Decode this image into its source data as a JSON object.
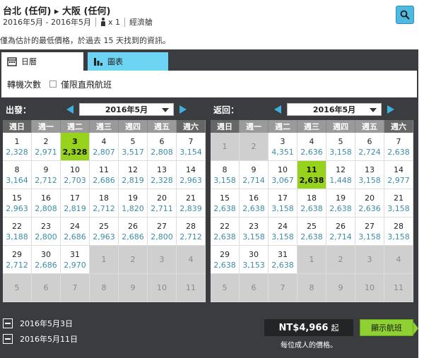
{
  "header": {
    "route": "台北 (任何) ▸ 大阪 (任何)",
    "dates": "2016年5月 - 2016年5月",
    "passengers": "x 1",
    "cabin": "經濟艙"
  },
  "notice": "僅為估計的最低價格，於過去 15 天找到的資訊。",
  "tabs": {
    "calendar": "日曆",
    "chart": "圖表"
  },
  "options": {
    "stops_label": "轉機次數",
    "direct_only": "僅限直飛航班"
  },
  "weekdays": [
    "週日",
    "週一",
    "週二",
    "週三",
    "週四",
    "週五",
    "週六"
  ],
  "outbound": {
    "label": "出發：",
    "month": "2016年5月",
    "cells": [
      {
        "d": "1",
        "p": "2,328"
      },
      {
        "d": "2",
        "p": "2,971"
      },
      {
        "d": "3",
        "p": "2,328",
        "sel": true
      },
      {
        "d": "4",
        "p": "2,807"
      },
      {
        "d": "5",
        "p": "3,517"
      },
      {
        "d": "6",
        "p": "2,808"
      },
      {
        "d": "7",
        "p": "3,154"
      },
      {
        "d": "8",
        "p": "3,164"
      },
      {
        "d": "9",
        "p": "2,712"
      },
      {
        "d": "10",
        "p": "2,703"
      },
      {
        "d": "11",
        "p": "2,686"
      },
      {
        "d": "12",
        "p": "2,819"
      },
      {
        "d": "13",
        "p": "2,328"
      },
      {
        "d": "14",
        "p": "2,963"
      },
      {
        "d": "15",
        "p": "2,963"
      },
      {
        "d": "16",
        "p": "2,808"
      },
      {
        "d": "17",
        "p": "2,819"
      },
      {
        "d": "18",
        "p": "2,712"
      },
      {
        "d": "19",
        "p": "1,820"
      },
      {
        "d": "20",
        "p": "2,711"
      },
      {
        "d": "21",
        "p": "2,839"
      },
      {
        "d": "22",
        "p": "3,188"
      },
      {
        "d": "23",
        "p": "2,800"
      },
      {
        "d": "24",
        "p": "2,686"
      },
      {
        "d": "25",
        "p": "2,963"
      },
      {
        "d": "26",
        "p": "2,686"
      },
      {
        "d": "27",
        "p": "2,800"
      },
      {
        "d": "28",
        "p": "2,712"
      },
      {
        "d": "29",
        "p": "2,712"
      },
      {
        "d": "30",
        "p": "2,686"
      },
      {
        "d": "31",
        "p": "2,970"
      },
      {
        "d": "1",
        "out": true
      },
      {
        "d": "2",
        "out": true
      },
      {
        "d": "3",
        "out": true
      },
      {
        "d": "4",
        "out": true
      },
      {
        "d": "5",
        "out": true
      },
      {
        "d": "6",
        "out": true
      },
      {
        "d": "7",
        "out": true
      },
      {
        "d": "8",
        "out": true
      },
      {
        "d": "9",
        "out": true
      },
      {
        "d": "10",
        "out": true
      },
      {
        "d": "11",
        "out": true
      }
    ]
  },
  "return": {
    "label": "返回：",
    "month": "2016年5月",
    "cells": [
      {
        "d": "1",
        "out": true
      },
      {
        "d": "2",
        "out": true
      },
      {
        "d": "3",
        "p": "4,351"
      },
      {
        "d": "4",
        "p": "2,636"
      },
      {
        "d": "5",
        "p": "3,158"
      },
      {
        "d": "6",
        "p": "2,724"
      },
      {
        "d": "7",
        "p": "2,638"
      },
      {
        "d": "8",
        "p": "3,158"
      },
      {
        "d": "9",
        "p": "2,714"
      },
      {
        "d": "10",
        "p": "3,067"
      },
      {
        "d": "11",
        "p": "2,638",
        "sel": true
      },
      {
        "d": "12",
        "p": "1,448"
      },
      {
        "d": "13",
        "p": "3,158"
      },
      {
        "d": "14",
        "p": "2,977"
      },
      {
        "d": "15",
        "p": "2,638"
      },
      {
        "d": "16",
        "p": "2,638"
      },
      {
        "d": "17",
        "p": "3,158"
      },
      {
        "d": "18",
        "p": "2,638"
      },
      {
        "d": "19",
        "p": "2,638"
      },
      {
        "d": "20",
        "p": "2,636"
      },
      {
        "d": "21",
        "p": "3,158"
      },
      {
        "d": "22",
        "p": "2,638"
      },
      {
        "d": "23",
        "p": "3,158"
      },
      {
        "d": "24",
        "p": "3,158"
      },
      {
        "d": "25",
        "p": "2,638"
      },
      {
        "d": "26",
        "p": "2,714"
      },
      {
        "d": "27",
        "p": "3,158"
      },
      {
        "d": "28",
        "p": "3,158"
      },
      {
        "d": "29",
        "p": "2,638"
      },
      {
        "d": "30",
        "p": "3,153"
      },
      {
        "d": "31",
        "p": "2,638"
      },
      {
        "d": "1",
        "out": true
      },
      {
        "d": "2",
        "out": true
      },
      {
        "d": "3",
        "out": true
      },
      {
        "d": "4",
        "out": true
      },
      {
        "d": "5",
        "out": true
      },
      {
        "d": "6",
        "out": true
      },
      {
        "d": "7",
        "out": true
      },
      {
        "d": "8",
        "out": true
      },
      {
        "d": "9",
        "out": true
      },
      {
        "d": "10",
        "out": true
      },
      {
        "d": "11",
        "out": true
      }
    ]
  },
  "footer": {
    "depart_date": "2016年5月3日",
    "return_date": "2016年5月11日",
    "price": "NT$4,966",
    "price_suffix": "起",
    "per_person": "每位成人的價格。",
    "show_flights": "顯示航班"
  },
  "colors": {
    "accent": "#3db0e0",
    "selected": "#97d21c",
    "panel": "#3a3c40",
    "price_text": "#3a8ea8"
  }
}
